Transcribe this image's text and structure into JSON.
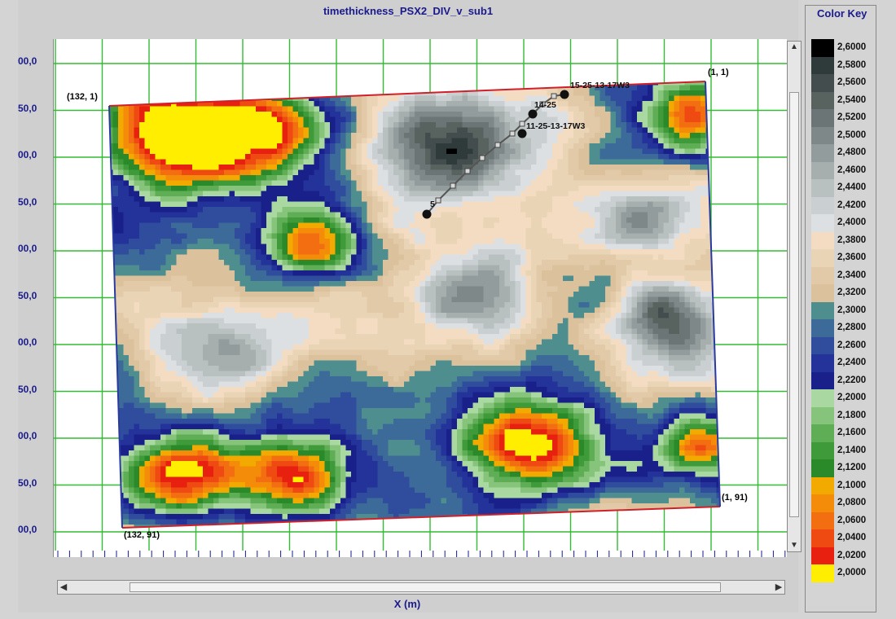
{
  "chart_data": {
    "type": "heatmap",
    "title": "timethickness_PSX2_DIV_v_sub1",
    "xlabel": "X (m)",
    "ylabel": "",
    "y_tick_labels": [
      "00,0",
      "50,0",
      "00,0",
      "50,0",
      "00,0",
      "50,0",
      "00,0",
      "50,0",
      "00,0",
      "50,0",
      "00,0"
    ],
    "grid": true,
    "legend_position": "right",
    "corner_labels": [
      "(132, 1)",
      "(1, 1)",
      "(1, 91)",
      "(132, 91)"
    ],
    "well_labels": [
      "15-25-13-17W3",
      "14-25",
      "11-25-13-17W3",
      "5"
    ],
    "color_key": {
      "title": "Color Key",
      "entries": [
        {
          "value": "2,6000",
          "color": "#000000"
        },
        {
          "value": "2,5800",
          "color": "#2f3a3a"
        },
        {
          "value": "2,5600",
          "color": "#434d4d"
        },
        {
          "value": "2,5400",
          "color": "#58625f"
        },
        {
          "value": "2,5200",
          "color": "#6b7575"
        },
        {
          "value": "2,5000",
          "color": "#7e8888"
        },
        {
          "value": "2,4800",
          "color": "#939c9c"
        },
        {
          "value": "2,4600",
          "color": "#a6aeae"
        },
        {
          "value": "2,4400",
          "color": "#b8c0c0"
        },
        {
          "value": "2,4200",
          "color": "#cad0d2"
        },
        {
          "value": "2,4000",
          "color": "#dde0e2"
        },
        {
          "value": "2,3800",
          "color": "#f3dcc2"
        },
        {
          "value": "2,3600",
          "color": "#ead4b6"
        },
        {
          "value": "2,3400",
          "color": "#e2caa8"
        },
        {
          "value": "2,3200",
          "color": "#dbc19c"
        },
        {
          "value": "2,3000",
          "color": "#4f8e8e"
        },
        {
          "value": "2,2800",
          "color": "#3c6b9a"
        },
        {
          "value": "2,2600",
          "color": "#2f4d9c"
        },
        {
          "value": "2,2400",
          "color": "#23339a"
        },
        {
          "value": "2,2200",
          "color": "#1a208a"
        },
        {
          "value": "2,2000",
          "color": "#a9d9a0"
        },
        {
          "value": "2,1800",
          "color": "#86c37b"
        },
        {
          "value": "2,1600",
          "color": "#5fae56"
        },
        {
          "value": "2,1400",
          "color": "#3f9a3a"
        },
        {
          "value": "2,1200",
          "color": "#2a8a2a"
        },
        {
          "value": "2,1000",
          "color": "#f2a900"
        },
        {
          "value": "2,0800",
          "color": "#f48c0a"
        },
        {
          "value": "2,0600",
          "color": "#f26e10"
        },
        {
          "value": "2,0400",
          "color": "#ee4a12"
        },
        {
          "value": "2,0200",
          "color": "#e8200f"
        },
        {
          "value": "2,0000",
          "color": "#ffee00"
        }
      ]
    }
  },
  "colors": {
    "outline_top": "#d0202a",
    "outline_side": "#2a3aa0",
    "grid": "#33bb33"
  }
}
